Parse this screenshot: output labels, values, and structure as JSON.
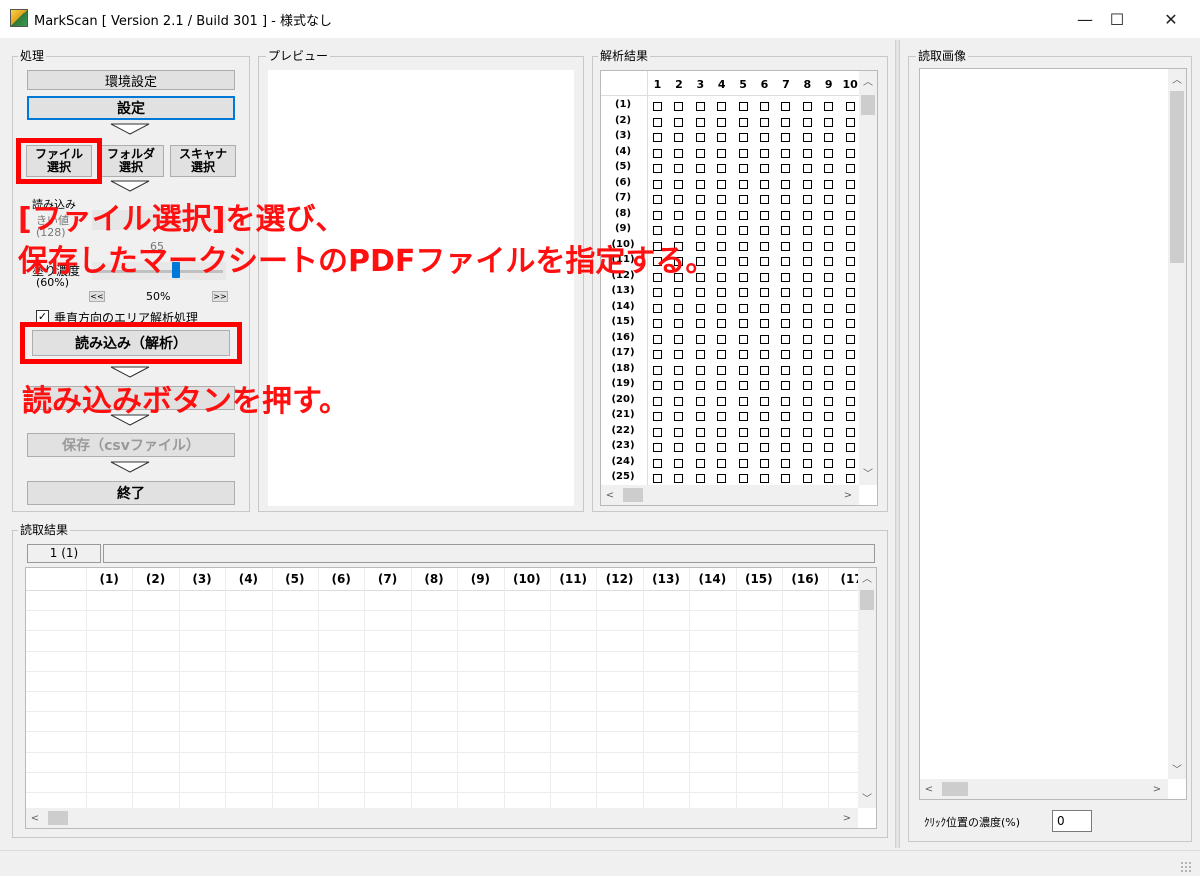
{
  "window": {
    "title": "MarkScan [ Version 2.1 / Build 301 ] - 様式なし",
    "minimize": "—",
    "maximize": "☐",
    "close": "✕"
  },
  "processing": {
    "label": "処理",
    "env_button": "環境設定",
    "settings_button": "設定",
    "file_line1": "ファイル",
    "file_line2": "選択",
    "folder_line1": "フォルダ",
    "folder_line2": "選択",
    "scanner_line1": "スキャナ",
    "scanner_line2": "選択",
    "read_label_partial": "読み込み",
    "threshold_partial": "きい値",
    "threshold_value_partial": "(128)",
    "slider_value_partial": "65",
    "density_label": "塗り濃度",
    "density_value": "(60%)",
    "slider_left": "<<",
    "slider_right": ">>",
    "slider_percent": "50%",
    "density_fraction": 0.5,
    "vertical_check_label": "垂直方向のエリア解析処理",
    "vertical_checked": true,
    "read_button": "読み込み（解析）",
    "save_csv_button": "保存（csvファイル）",
    "exit_button": "終了"
  },
  "preview": {
    "label": "プレビュー"
  },
  "analysis": {
    "label": "解析結果",
    "columns": [
      "1",
      "2",
      "3",
      "4",
      "5",
      "6",
      "7",
      "8",
      "9",
      "10"
    ],
    "rows": [
      "(1)",
      "(2)",
      "(3)",
      "(4)",
      "(5)",
      "(6)",
      "(7)",
      "(8)",
      "(9)",
      "(10)",
      "(11)",
      "(12)",
      "(13)",
      "(14)",
      "(15)",
      "(16)",
      "(17)",
      "(18)",
      "(19)",
      "(20)",
      "(21)",
      "(22)",
      "(23)",
      "(24)",
      "(25)"
    ]
  },
  "read_results": {
    "label": "読取結果",
    "page_indicator": "1 (1)",
    "columns": [
      "(1)",
      "(2)",
      "(3)",
      "(4)",
      "(5)",
      "(6)",
      "(7)",
      "(8)",
      "(9)",
      "(10)",
      "(11)",
      "(12)",
      "(13)",
      "(14)",
      "(15)",
      "(16)",
      "(17"
    ]
  },
  "read_image": {
    "label": "読取画像",
    "click_density_label": "ｸﾘｯｸ位置の濃度(%)",
    "click_density_value": "0"
  },
  "annotations": {
    "step1_line1": "[ファイル選択]を選び、",
    "step1_line2": "保存したマークシートのPDFファイルを指定する。",
    "step2": "読み込みボタンを押す。",
    "color": "#ff0000"
  },
  "scroll": {
    "up": "︿",
    "down": "﹀",
    "left": "<",
    "right": ">"
  }
}
